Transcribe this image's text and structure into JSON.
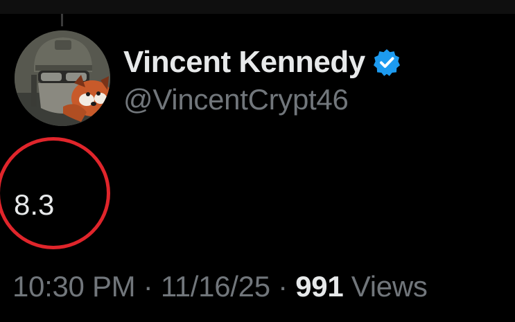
{
  "tweet": {
    "author": {
      "display_name": "Vincent Kennedy",
      "handle": "@VincentCrypt46",
      "verified": true,
      "verified_icon": "verified-badge-icon",
      "avatar_description": "avatar"
    },
    "text": "8.3",
    "time": "10:30 PM",
    "separator": "·",
    "date": "11/16/25",
    "views_count": "991",
    "views_label": "Views"
  },
  "colors": {
    "background": "#000000",
    "primary_text": "#e7e9ea",
    "secondary_text": "#71767b",
    "verified_blue": "#1d9bf0",
    "annotation_red": "#e0252b"
  }
}
